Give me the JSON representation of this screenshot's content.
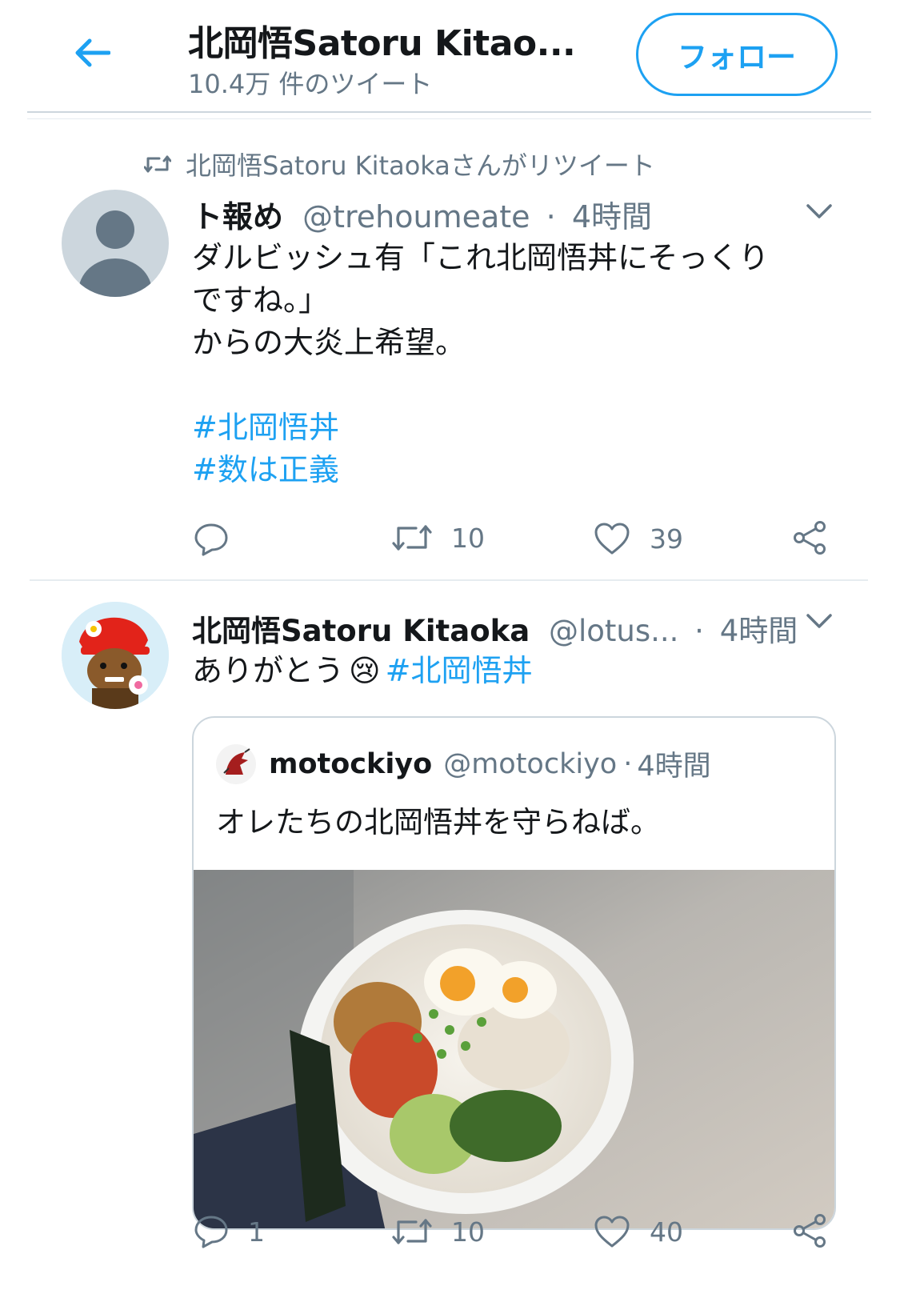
{
  "header": {
    "profile_name": "北岡悟Satoru Kitao...",
    "tweet_count": "10.4万 件のツイート",
    "follow_label": "フォロー"
  },
  "tweet1": {
    "retweet_context": "北岡悟Satoru Kitaokaさんがリツイート",
    "display_name": "ト報め",
    "handle": "@trehoumeate",
    "separator": "·",
    "time": "4時間",
    "text_line1": "ダルビッシュ有「これ北岡悟丼にそっくり",
    "text_line2": "ですね。」",
    "text_line3": "からの大炎上希望。",
    "hashtag1": "#北岡悟丼",
    "hashtag2": "#数は正義",
    "reply_count": "",
    "retweet_count": "10",
    "like_count": "39"
  },
  "tweet2": {
    "display_name": "北岡悟Satoru Kitaoka",
    "handle": "@lotus...",
    "separator": "·",
    "time": "4時間",
    "text": "ありがとう",
    "emoji": "😢",
    "hashtag": "#北岡悟丼",
    "reply_count": "1",
    "retweet_count": "10",
    "like_count": "40",
    "quote": {
      "display_name": "motockiyo",
      "handle": "@motockiyo",
      "separator": "·",
      "time": "4時間",
      "text": "オレたちの北岡悟丼を守らねば。"
    }
  },
  "colors": {
    "accent": "#1da1f2",
    "secondary_text": "#657786",
    "divider": "#e6ecf0"
  }
}
